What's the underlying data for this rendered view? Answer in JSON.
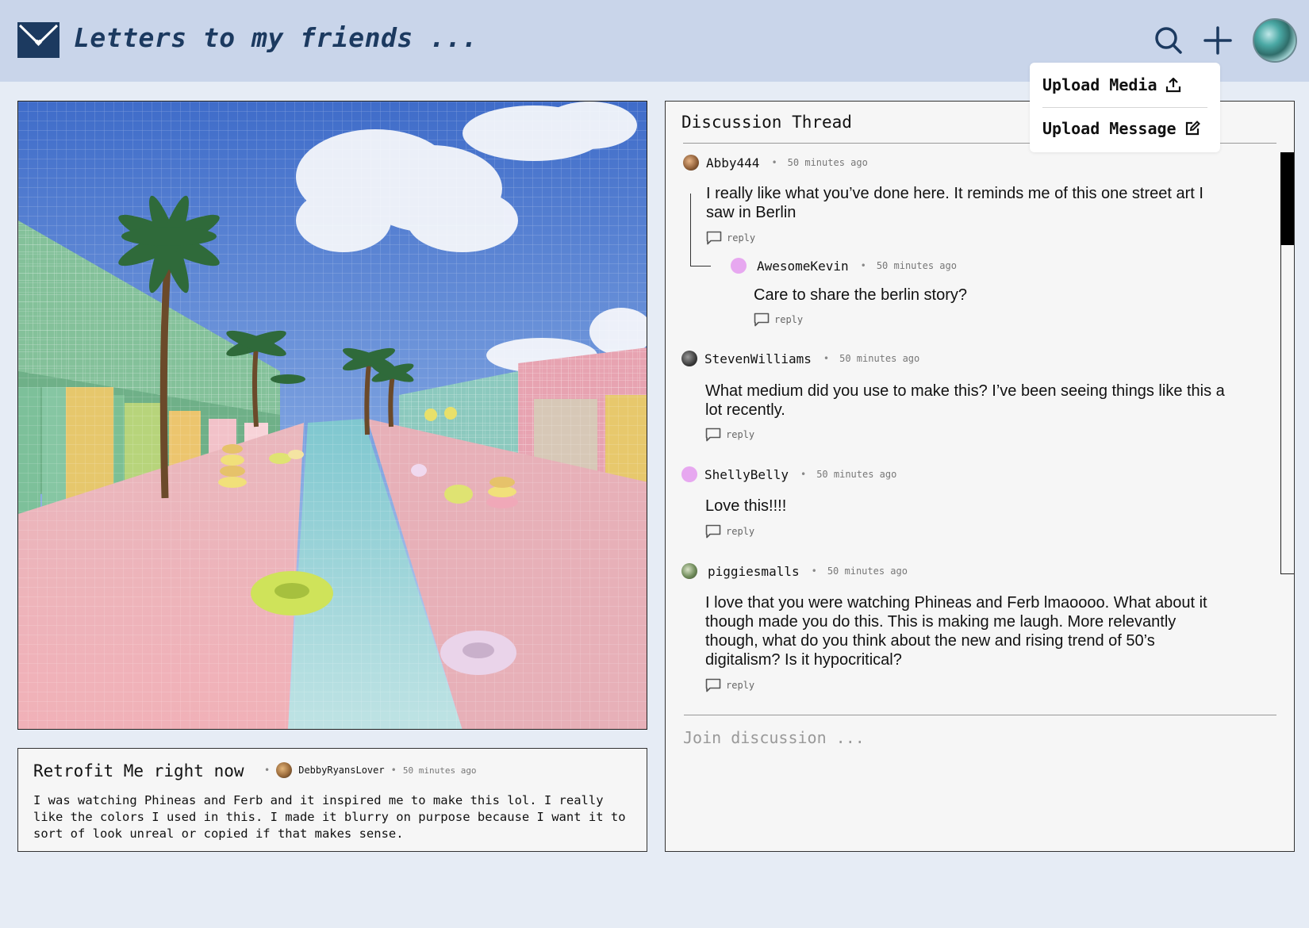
{
  "app": {
    "title": "Letters to my friends ...",
    "accent": "#1c3a60",
    "header_bg": "#c9d5ea"
  },
  "header": {
    "icons": [
      "search-icon",
      "plus-icon",
      "avatar"
    ]
  },
  "menu": {
    "upload_media": "Upload Media",
    "upload_message": "Upload Message"
  },
  "post": {
    "title": "Retrofit Me right now",
    "author": "DebbyRyansLover",
    "time": "50 minutes ago",
    "body": "I was watching Phineas and Ferb and it inspired me to make this lol. I really like the colors I used in this. I made it blurry on purpose because I want it to sort of look unreal or copied if that makes sense."
  },
  "thread": {
    "title": "Discussion Thread",
    "reply_label": "reply",
    "join_placeholder": "Join discussion ...",
    "comments": [
      {
        "user": "Abby444",
        "time": "50 minutes ago",
        "text": "I really like what you’ve done here. It reminds me of this one street art I saw in Berlin",
        "avatar_color": "#a9794a"
      },
      {
        "user": "AwesomeKevin",
        "time": "50 minutes ago",
        "text": "Care to share the berlin story?",
        "avatar_color": "#e7a8f0"
      },
      {
        "user": "StevenWilliams",
        "time": "50 minutes ago",
        "text": "What medium did you use to make this? I’ve been seeing things like this a lot recently.",
        "avatar_color": "#3a3a3a"
      },
      {
        "user": "ShellyBelly",
        "time": "50 minutes ago",
        "text": "Love this!!!!",
        "avatar_color": "#e7a8f0"
      },
      {
        "user": "piggiesmalls",
        "time": "50 minutes ago",
        "text": "I love that you were watching Phineas and Ferb lmaoooo. What about it though made you do this. This is making me laugh. More relevantly though, what do you think about the new and rising trend of 50’s digitalism? Is it hypocritical?",
        "avatar_color": "#6f8b5a"
      }
    ]
  }
}
